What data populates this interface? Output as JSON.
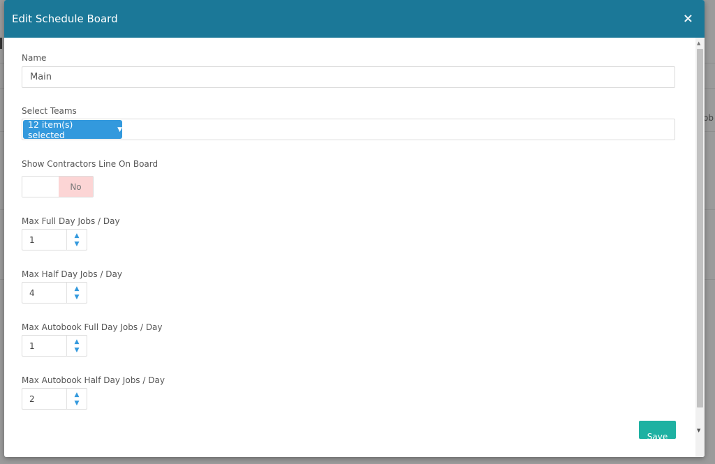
{
  "modal": {
    "title": "Edit Schedule Board",
    "close_glyph": "×"
  },
  "background": {
    "partial_text": "ob"
  },
  "form": {
    "name_label": "Name",
    "name_value": "Main",
    "teams_label": "Select Teams",
    "teams_selected": "12 item(s) selected",
    "teams_caret": "▼",
    "contractors_label": "Show Contractors Line On Board",
    "contractors_value": "No",
    "spinners": [
      {
        "label": "Max Full Day Jobs / Day",
        "value": "1"
      },
      {
        "label": "Max Half Day Jobs / Day",
        "value": "4"
      },
      {
        "label": "Max Autobook Full Day Jobs / Day",
        "value": "1"
      },
      {
        "label": "Max Autobook Half Day Jobs / Day",
        "value": "2"
      }
    ],
    "spin_up_glyph": "▲",
    "spin_down_glyph": "▼",
    "save_label": "Save"
  },
  "scrollbar": {
    "up_glyph": "▲",
    "down_glyph": "▼"
  },
  "colors": {
    "header": "#1b7898",
    "chip": "#3399dd",
    "toggle_no": "#fcd5d5",
    "save": "#1eb1a2"
  }
}
